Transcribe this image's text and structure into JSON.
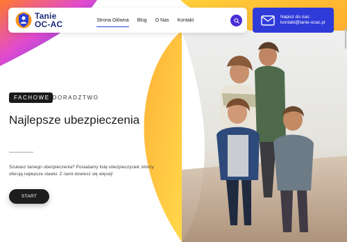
{
  "brand": {
    "name_line1": "Tanie",
    "name_line2": "OC-AC",
    "logo_icon": "shield-person-icon"
  },
  "nav": {
    "items": [
      {
        "label": "Strona Główna",
        "active": true
      },
      {
        "label": "Blog",
        "active": false
      },
      {
        "label": "O Nas",
        "active": false
      },
      {
        "label": "Kontakt",
        "active": false
      }
    ],
    "search_icon": "search-icon"
  },
  "contact": {
    "icon": "mail-icon",
    "text": "Napisz do nas: kontakt@tanie-ocac.pl"
  },
  "hero": {
    "tag_dark": "FACHOWE",
    "tag_light": "DORADZTWO",
    "title": "Najlepsze ubezpieczenia",
    "description": "Szukasz taniego ubezpieczenia? Posiadamy listę ubezpieczycieli, którzy oferują najlepsze stawki. Z nami dowiesz się więcej!",
    "cta_label": "START"
  },
  "colors": {
    "accent_blue": "#2f3bd9",
    "accent_purple": "#4a2fd6",
    "accent_orange": "#fbb040",
    "accent_yellow": "#ffd23f",
    "dark": "#1d1d1d"
  }
}
